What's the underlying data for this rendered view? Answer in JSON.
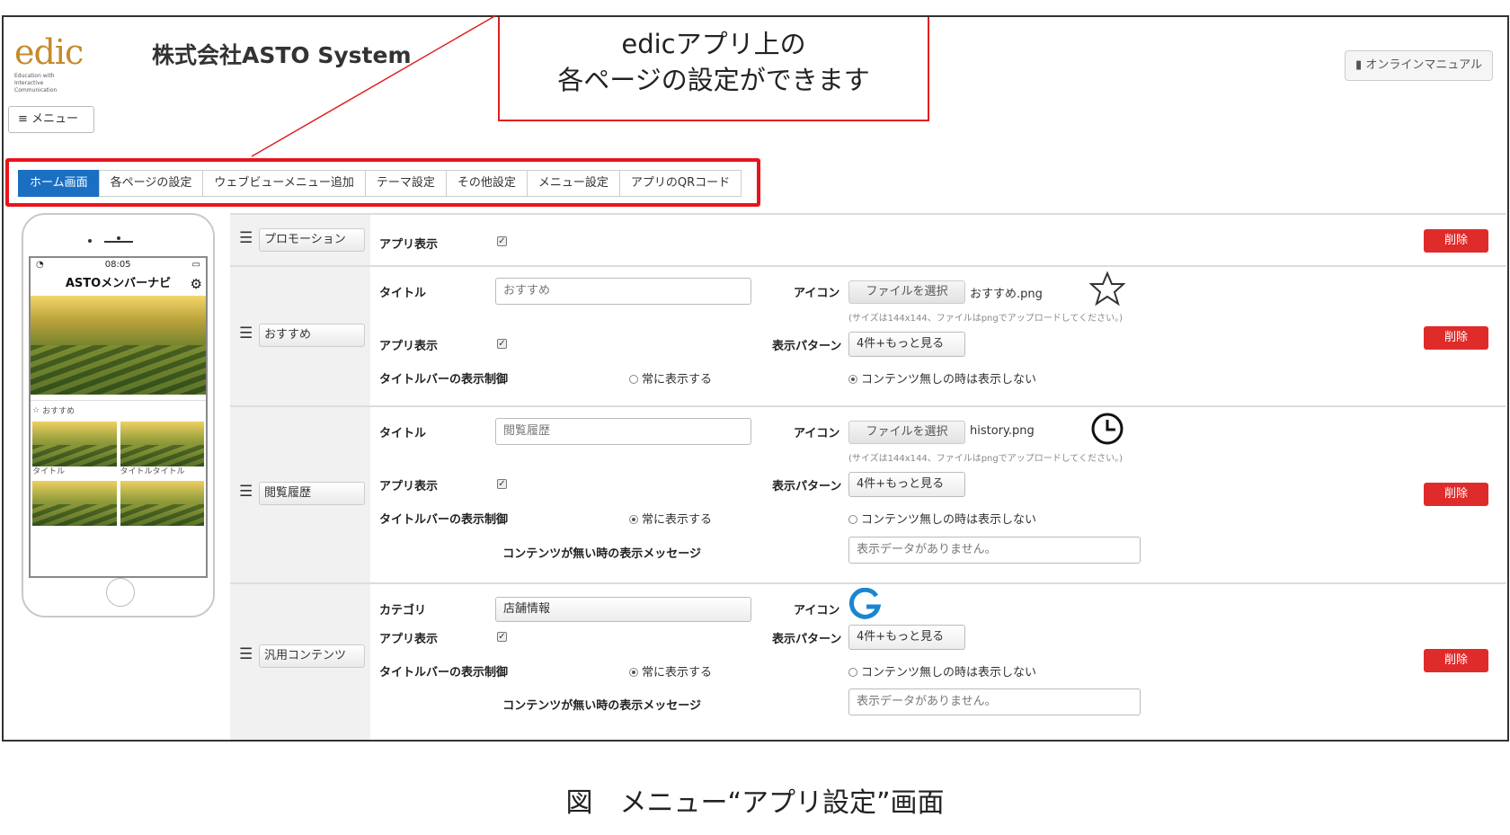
{
  "callout": {
    "line1": "edicアプリ上の",
    "line2": "各ページの設定ができます"
  },
  "header": {
    "logo": "edic",
    "logo_sub": "Education with\nInteractive\nCommunication",
    "company": "株式会社ASTO System",
    "menu_label": "≡ メニュー",
    "manual_label": "オンラインマニュアル"
  },
  "tabs": [
    {
      "label": "ホーム画面"
    },
    {
      "label": "各ページの設定"
    },
    {
      "label": "ウェブビューメニュー追加"
    },
    {
      "label": "テーマ設定"
    },
    {
      "label": "その他設定"
    },
    {
      "label": "メニュー設定"
    },
    {
      "label": "アプリのQRコード"
    }
  ],
  "phone": {
    "time": "08:05",
    "app_title": "ASTOメンバーナビ",
    "section_label": "おすすめ",
    "captions": [
      "タイトル",
      "タイトルタイトル"
    ]
  },
  "labels": {
    "title": "タイトル",
    "icon": "アイコン",
    "app_display": "アプリ表示",
    "pattern": "表示パターン",
    "titlebar_control": "タイトルバーの表示制御",
    "always_show": "常に表示する",
    "hide_when_empty": "コンテンツ無しの時は表示しない",
    "empty_message": "コンテンツが無い時の表示メッセージ",
    "category": "カテゴリ",
    "file_select": "ファイルを選択",
    "size_hint": "(サイズは144x144、ファイルはpngでアップロードしてください。)",
    "delete": "削除",
    "checked": "✓"
  },
  "rows": [
    {
      "name": "プロモーション"
    },
    {
      "name": "おすすめ",
      "title_value": "おすすめ",
      "file_name": "おすすめ.png",
      "pattern": "4件+もっと見る"
    },
    {
      "name": "閲覧履歴",
      "title_value": "閲覧履歴",
      "file_name": "history.png",
      "pattern": "4件+もっと見る",
      "empty_message": "表示データがありません。"
    },
    {
      "name": "汎用コンテンツ",
      "category": "店舗情報",
      "pattern": "4件+もっと見る",
      "empty_message": "表示データがありません。"
    }
  ],
  "caption": "図　メニュー“アプリ設定”画面",
  "colors": {
    "active_tab": "#1a6fc2",
    "delete": "#e02b2b",
    "highlight": "#e8141b",
    "logo": "#c58a2a"
  }
}
